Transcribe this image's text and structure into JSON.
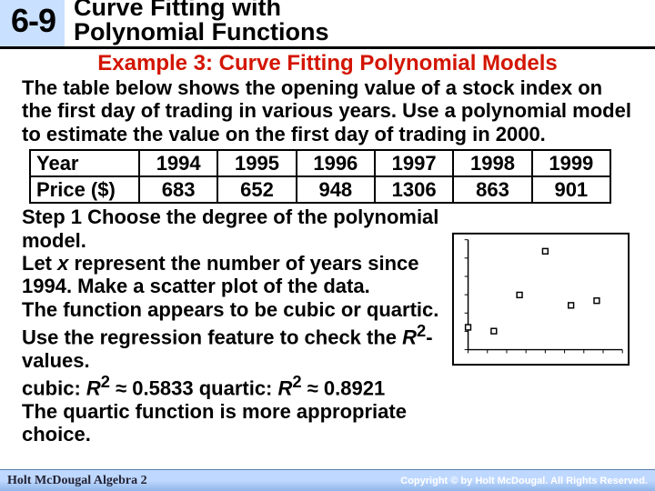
{
  "header": {
    "section": "6-9",
    "title_line1": "Curve Fitting with",
    "title_line2": "Polynomial Functions"
  },
  "example_heading": "Example 3: Curve Fitting Polynomial Models",
  "intro": "The table below shows the opening value of a stock index on the first day of trading in various years. Use a polynomial model to estimate the value on the first day of trading in 2000.",
  "table": {
    "row1_label": "Year",
    "years": [
      "1994",
      "1995",
      "1996",
      "1997",
      "1998",
      "1999"
    ],
    "row2_label": "Price ($)",
    "prices": [
      "683",
      "652",
      "948",
      "1306",
      "863",
      "901"
    ]
  },
  "step": {
    "line1": "Step 1 Choose the degree of the polynomial model.",
    "line2_a": "Let ",
    "line2_x": "x",
    "line2_b": " represent the number of years since 1994. Make a scatter plot of the data.",
    "line3": "The function appears to be cubic or quartic.",
    "line4_a": "Use the regression feature to check the ",
    "line4_r": "R",
    "line4_sup": "2",
    "line4_b": "-values.",
    "line5_a": "cubic: ",
    "line5_r1": "R",
    "line5_s1": "2",
    "line5_b": " ≈ 0.5833 quartic: ",
    "line5_r2": "R",
    "line5_s2": "2",
    "line5_c": " ≈ 0.8921",
    "line6": "The quartic function is more appropriate choice."
  },
  "footer": {
    "publisher": "Holt McDougal Algebra 2",
    "copyright": "Copyright © by Holt McDougal. All Rights Reserved."
  },
  "chart_data": {
    "type": "scatter",
    "title": "",
    "xlabel": "",
    "ylabel": "",
    "x": [
      0,
      1,
      2,
      3,
      4,
      5
    ],
    "y": [
      683,
      652,
      948,
      1306,
      863,
      901
    ],
    "xlim": [
      0,
      6
    ],
    "ylim": [
      500,
      1400
    ]
  }
}
